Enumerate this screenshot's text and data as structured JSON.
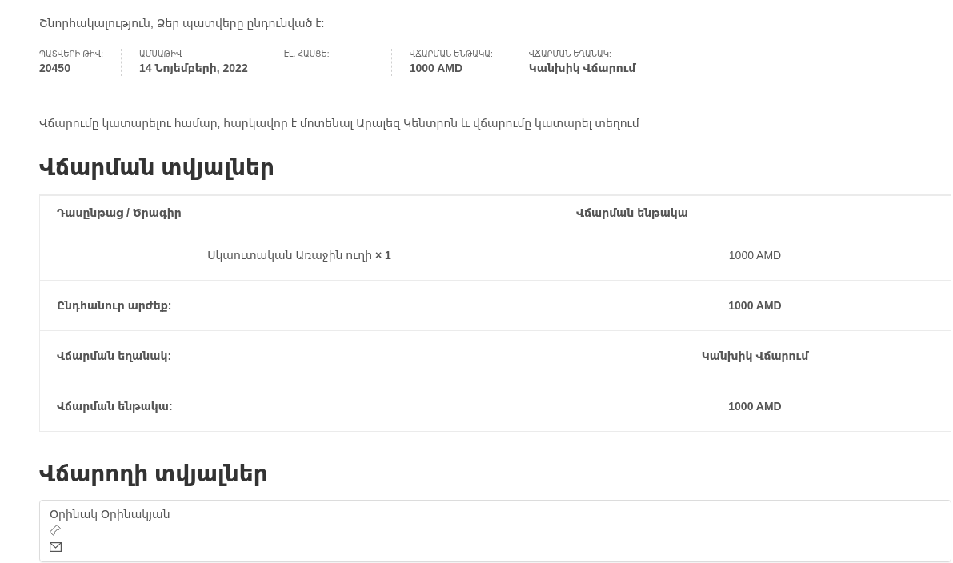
{
  "confirmation": "Շնորհակալություն, Ձեր պատվերը ընդունված է:",
  "order_details": [
    {
      "label": "ՊԱՏՎԵՐԻ ԹԻՎ:",
      "value": "20450"
    },
    {
      "label": "ԱՄՍԱԹԻՎ",
      "value": "14 Նոյեմբերի, 2022"
    },
    {
      "label": "ԷԼ. ՀԱՍՑԵ:"
    },
    {
      "label": "ՎՃԱՐՄԱՆ ԵՆԹԱԿԱ:",
      "value": "1000 AMD"
    },
    {
      "label": "ՎՃԱՐՄԱՆ ԵՂԱՆԱԿ:",
      "value": "Կանխիկ Վճարում"
    }
  ],
  "payment_note": "Վճարումը կատարելու համար, հարկավոր է մոտենալ Արալեզ Կենտրոն և վճարումը կատարել տեղում",
  "payment_details": {
    "title": "Վճարման տվյալներ",
    "columns": [
      "Դասընթաց / Ծրագիր",
      "Վճարման ենթակա"
    ],
    "items": [
      {
        "product": "Սկաուտական Առաջին ուղի **× 1**",
        "amount": "1000 AMD"
      }
    ],
    "totals": [
      {
        "label": "Ընդհանուր արժեք:",
        "value": "1000 AMD"
      },
      {
        "label": "Վճարման եղանակ:",
        "value": "Կանխիկ Վճարում"
      },
      {
        "label": "Վճարման ենթակա:",
        "value": "1000 AMD"
      }
    ]
  },
  "payer_details": {
    "title": "Վճարողի տվյալներ",
    "name": "Օրինակ Օրինակյան"
  }
}
